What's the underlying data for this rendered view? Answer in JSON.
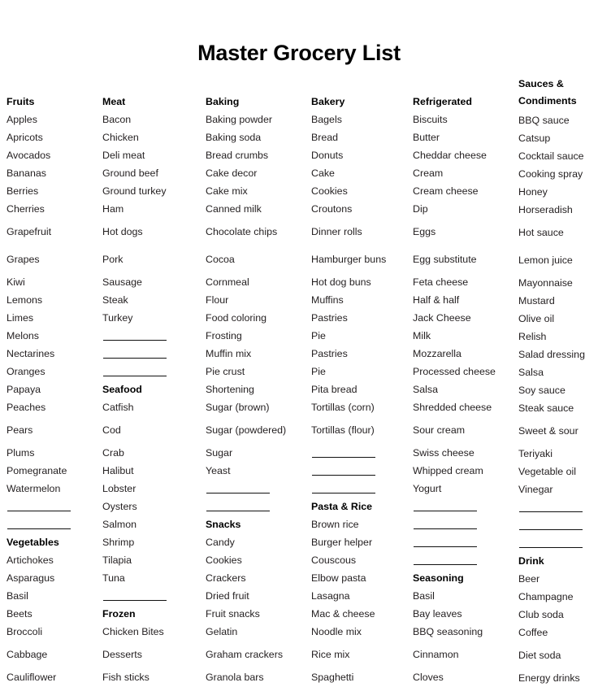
{
  "document": {
    "title": "Master Grocery List"
  },
  "columns": [
    {
      "name": "column-fruits-vegetables",
      "cells": [
        {
          "kind": "empty",
          "text": ""
        },
        {
          "kind": "header",
          "text": "Fruits"
        },
        {
          "kind": "item",
          "text": "Apples"
        },
        {
          "kind": "item",
          "text": "Apricots"
        },
        {
          "kind": "item",
          "text": "Avocados"
        },
        {
          "kind": "item",
          "text": "Bananas"
        },
        {
          "kind": "item",
          "text": "Berries"
        },
        {
          "kind": "item",
          "text": "Cherries"
        },
        {
          "kind": "item",
          "text": "Grapefruit",
          "tall": true
        },
        {
          "kind": "item",
          "text": "Grapes",
          "tall": true
        },
        {
          "kind": "item",
          "text": "Kiwi"
        },
        {
          "kind": "item",
          "text": "Lemons"
        },
        {
          "kind": "item",
          "text": "Limes"
        },
        {
          "kind": "item",
          "text": "Melons"
        },
        {
          "kind": "item",
          "text": "Nectarines"
        },
        {
          "kind": "item",
          "text": "Oranges"
        },
        {
          "kind": "item",
          "text": "Papaya"
        },
        {
          "kind": "item",
          "text": "Peaches"
        },
        {
          "kind": "item",
          "text": "Pears",
          "tall": true
        },
        {
          "kind": "item",
          "text": "Plums"
        },
        {
          "kind": "item",
          "text": "Pomegranate"
        },
        {
          "kind": "item",
          "text": "Watermelon"
        },
        {
          "kind": "blank",
          "text": ""
        },
        {
          "kind": "blank",
          "text": ""
        },
        {
          "kind": "header",
          "text": "Vegetables"
        },
        {
          "kind": "item",
          "text": "Artichokes"
        },
        {
          "kind": "item",
          "text": "Asparagus"
        },
        {
          "kind": "item",
          "text": "Basil"
        },
        {
          "kind": "item",
          "text": "Beets"
        },
        {
          "kind": "item",
          "text": "Broccoli"
        },
        {
          "kind": "item",
          "text": "Cabbage",
          "tall": true
        },
        {
          "kind": "item",
          "text": "Cauliflower"
        }
      ]
    },
    {
      "name": "column-meat-seafood-frozen",
      "cells": [
        {
          "kind": "empty",
          "text": ""
        },
        {
          "kind": "header",
          "text": "Meat"
        },
        {
          "kind": "item",
          "text": "Bacon"
        },
        {
          "kind": "item",
          "text": "Chicken"
        },
        {
          "kind": "item",
          "text": "Deli meat"
        },
        {
          "kind": "item",
          "text": "Ground beef"
        },
        {
          "kind": "item",
          "text": "Ground turkey"
        },
        {
          "kind": "item",
          "text": "Ham"
        },
        {
          "kind": "item",
          "text": "Hot dogs",
          "tall": true
        },
        {
          "kind": "item",
          "text": "Pork",
          "tall": true
        },
        {
          "kind": "item",
          "text": "Sausage"
        },
        {
          "kind": "item",
          "text": "Steak"
        },
        {
          "kind": "item",
          "text": "Turkey"
        },
        {
          "kind": "blank",
          "text": ""
        },
        {
          "kind": "blank",
          "text": ""
        },
        {
          "kind": "blank",
          "text": ""
        },
        {
          "kind": "header",
          "text": "Seafood"
        },
        {
          "kind": "item",
          "text": "Catfish"
        },
        {
          "kind": "item",
          "text": "Cod",
          "tall": true
        },
        {
          "kind": "item",
          "text": "Crab"
        },
        {
          "kind": "item",
          "text": "Halibut"
        },
        {
          "kind": "item",
          "text": "Lobster"
        },
        {
          "kind": "item",
          "text": "Oysters"
        },
        {
          "kind": "item",
          "text": "Salmon"
        },
        {
          "kind": "item",
          "text": "Shrimp"
        },
        {
          "kind": "item",
          "text": "Tilapia"
        },
        {
          "kind": "item",
          "text": "Tuna"
        },
        {
          "kind": "blank",
          "text": ""
        },
        {
          "kind": "header",
          "text": "Frozen"
        },
        {
          "kind": "item",
          "text": "Chicken Bites"
        },
        {
          "kind": "item",
          "text": "Desserts",
          "tall": true
        },
        {
          "kind": "item",
          "text": "Fish sticks"
        }
      ]
    },
    {
      "name": "column-baking-snacks",
      "cells": [
        {
          "kind": "empty",
          "text": ""
        },
        {
          "kind": "header",
          "text": "Baking"
        },
        {
          "kind": "item",
          "text": "Baking powder"
        },
        {
          "kind": "item",
          "text": "Baking soda"
        },
        {
          "kind": "item",
          "text": "Bread crumbs"
        },
        {
          "kind": "item",
          "text": "Cake decor"
        },
        {
          "kind": "item",
          "text": "Cake mix"
        },
        {
          "kind": "item",
          "text": "Canned milk"
        },
        {
          "kind": "item",
          "text": "Chocolate chips",
          "tall": true
        },
        {
          "kind": "item",
          "text": "Cocoa",
          "tall": true
        },
        {
          "kind": "item",
          "text": "Cornmeal"
        },
        {
          "kind": "item",
          "text": "Flour"
        },
        {
          "kind": "item",
          "text": "Food coloring"
        },
        {
          "kind": "item",
          "text": "Frosting"
        },
        {
          "kind": "item",
          "text": "Muffin mix"
        },
        {
          "kind": "item",
          "text": "Pie crust"
        },
        {
          "kind": "item",
          "text": "Shortening"
        },
        {
          "kind": "item",
          "text": "Sugar (brown)"
        },
        {
          "kind": "item",
          "text": "Sugar (powdered)",
          "tall": true
        },
        {
          "kind": "item",
          "text": "Sugar"
        },
        {
          "kind": "item",
          "text": "Yeast"
        },
        {
          "kind": "blank",
          "text": ""
        },
        {
          "kind": "blank",
          "text": ""
        },
        {
          "kind": "header",
          "text": "Snacks"
        },
        {
          "kind": "item",
          "text": "Candy"
        },
        {
          "kind": "item",
          "text": "Cookies"
        },
        {
          "kind": "item",
          "text": "Crackers"
        },
        {
          "kind": "item",
          "text": "Dried fruit"
        },
        {
          "kind": "item",
          "text": "Fruit snacks"
        },
        {
          "kind": "item",
          "text": "Gelatin"
        },
        {
          "kind": "item",
          "text": "Graham crackers",
          "tall": true
        },
        {
          "kind": "item",
          "text": "Granola bars"
        }
      ]
    },
    {
      "name": "column-bakery-pasta-rice",
      "cells": [
        {
          "kind": "empty",
          "text": ""
        },
        {
          "kind": "header",
          "text": "Bakery"
        },
        {
          "kind": "item",
          "text": "Bagels"
        },
        {
          "kind": "item",
          "text": "Bread"
        },
        {
          "kind": "item",
          "text": "Donuts"
        },
        {
          "kind": "item",
          "text": "Cake"
        },
        {
          "kind": "item",
          "text": "Cookies"
        },
        {
          "kind": "item",
          "text": "Croutons"
        },
        {
          "kind": "item",
          "text": "Dinner rolls",
          "tall": true
        },
        {
          "kind": "item",
          "text": "Hamburger buns",
          "tall": true
        },
        {
          "kind": "item",
          "text": "Hot dog buns"
        },
        {
          "kind": "item",
          "text": "Muffins"
        },
        {
          "kind": "item",
          "text": "Pastries"
        },
        {
          "kind": "item",
          "text": "Pie"
        },
        {
          "kind": "item",
          "text": "Pastries"
        },
        {
          "kind": "item",
          "text": "Pie"
        },
        {
          "kind": "item",
          "text": "Pita bread"
        },
        {
          "kind": "item",
          "text": "Tortillas (corn)"
        },
        {
          "kind": "item",
          "text": "Tortillas (flour)",
          "tall": true
        },
        {
          "kind": "blank",
          "text": ""
        },
        {
          "kind": "blank",
          "text": ""
        },
        {
          "kind": "blank",
          "text": ""
        },
        {
          "kind": "header",
          "text": "Pasta & Rice"
        },
        {
          "kind": "item",
          "text": "Brown rice"
        },
        {
          "kind": "item",
          "text": "Burger helper"
        },
        {
          "kind": "item",
          "text": "Couscous"
        },
        {
          "kind": "item",
          "text": "Elbow pasta"
        },
        {
          "kind": "item",
          "text": "Lasagna"
        },
        {
          "kind": "item",
          "text": "Mac & cheese"
        },
        {
          "kind": "item",
          "text": "Noodle mix"
        },
        {
          "kind": "item",
          "text": "Rice mix",
          "tall": true
        },
        {
          "kind": "item",
          "text": "Spaghetti"
        }
      ]
    },
    {
      "name": "column-refrigerated-seasoning",
      "cells": [
        {
          "kind": "empty",
          "text": ""
        },
        {
          "kind": "header",
          "text": "Refrigerated"
        },
        {
          "kind": "item",
          "text": "Biscuits"
        },
        {
          "kind": "item",
          "text": "Butter"
        },
        {
          "kind": "item",
          "text": "Cheddar cheese"
        },
        {
          "kind": "item",
          "text": "Cream"
        },
        {
          "kind": "item",
          "text": "Cream cheese"
        },
        {
          "kind": "item",
          "text": "Dip"
        },
        {
          "kind": "item",
          "text": "Eggs",
          "tall": true
        },
        {
          "kind": "item",
          "text": "Egg substitute",
          "tall": true
        },
        {
          "kind": "item",
          "text": "Feta cheese"
        },
        {
          "kind": "item",
          "text": "Half & half"
        },
        {
          "kind": "item",
          "text": "Jack Cheese"
        },
        {
          "kind": "item",
          "text": "Milk"
        },
        {
          "kind": "item",
          "text": "Mozzarella"
        },
        {
          "kind": "item",
          "text": "Processed cheese"
        },
        {
          "kind": "item",
          "text": "Salsa"
        },
        {
          "kind": "item",
          "text": "Shredded cheese"
        },
        {
          "kind": "item",
          "text": "Sour cream",
          "tall": true
        },
        {
          "kind": "item",
          "text": "Swiss cheese"
        },
        {
          "kind": "item",
          "text": "Whipped cream"
        },
        {
          "kind": "item",
          "text": "Yogurt"
        },
        {
          "kind": "blank",
          "text": ""
        },
        {
          "kind": "blank",
          "text": ""
        },
        {
          "kind": "blank",
          "text": ""
        },
        {
          "kind": "blank",
          "text": ""
        },
        {
          "kind": "header",
          "text": "Seasoning"
        },
        {
          "kind": "item",
          "text": "Basil"
        },
        {
          "kind": "item",
          "text": "Bay leaves"
        },
        {
          "kind": "item",
          "text": "BBQ seasoning"
        },
        {
          "kind": "item",
          "text": "Cinnamon",
          "tall": true
        },
        {
          "kind": "item",
          "text": "Cloves"
        }
      ]
    },
    {
      "name": "column-sauces-condiments-drink",
      "cells": [
        {
          "kind": "header2",
          "text": "Sauces & Condiments"
        },
        {
          "kind": "item",
          "text": "BBQ sauce"
        },
        {
          "kind": "item",
          "text": "Catsup"
        },
        {
          "kind": "item",
          "text": "Cocktail sauce"
        },
        {
          "kind": "item",
          "text": "Cooking spray"
        },
        {
          "kind": "item",
          "text": "Honey"
        },
        {
          "kind": "item",
          "text": "Horseradish"
        },
        {
          "kind": "item",
          "text": "Hot sauce",
          "tall": true
        },
        {
          "kind": "item",
          "text": "Lemon juice",
          "tall": true
        },
        {
          "kind": "item",
          "text": "Mayonnaise"
        },
        {
          "kind": "item",
          "text": "Mustard"
        },
        {
          "kind": "item",
          "text": "Olive oil"
        },
        {
          "kind": "item",
          "text": "Relish"
        },
        {
          "kind": "item",
          "text": "Salad dressing"
        },
        {
          "kind": "item",
          "text": "Salsa"
        },
        {
          "kind": "item",
          "text": "Soy sauce"
        },
        {
          "kind": "item",
          "text": "Steak sauce"
        },
        {
          "kind": "item",
          "text": "Sweet & sour",
          "tall": true
        },
        {
          "kind": "item",
          "text": "Teriyaki"
        },
        {
          "kind": "item",
          "text": "Vegetable oil"
        },
        {
          "kind": "item",
          "text": "Vinegar"
        },
        {
          "kind": "blank",
          "text": ""
        },
        {
          "kind": "blank",
          "text": ""
        },
        {
          "kind": "blank",
          "text": ""
        },
        {
          "kind": "header",
          "text": "Drink"
        },
        {
          "kind": "item",
          "text": "Beer"
        },
        {
          "kind": "item",
          "text": "Champagne"
        },
        {
          "kind": "item",
          "text": "Club soda"
        },
        {
          "kind": "item",
          "text": "Coffee"
        },
        {
          "kind": "item",
          "text": "Diet soda",
          "tall": true
        },
        {
          "kind": "item",
          "text": "Energy drinks"
        }
      ]
    }
  ]
}
